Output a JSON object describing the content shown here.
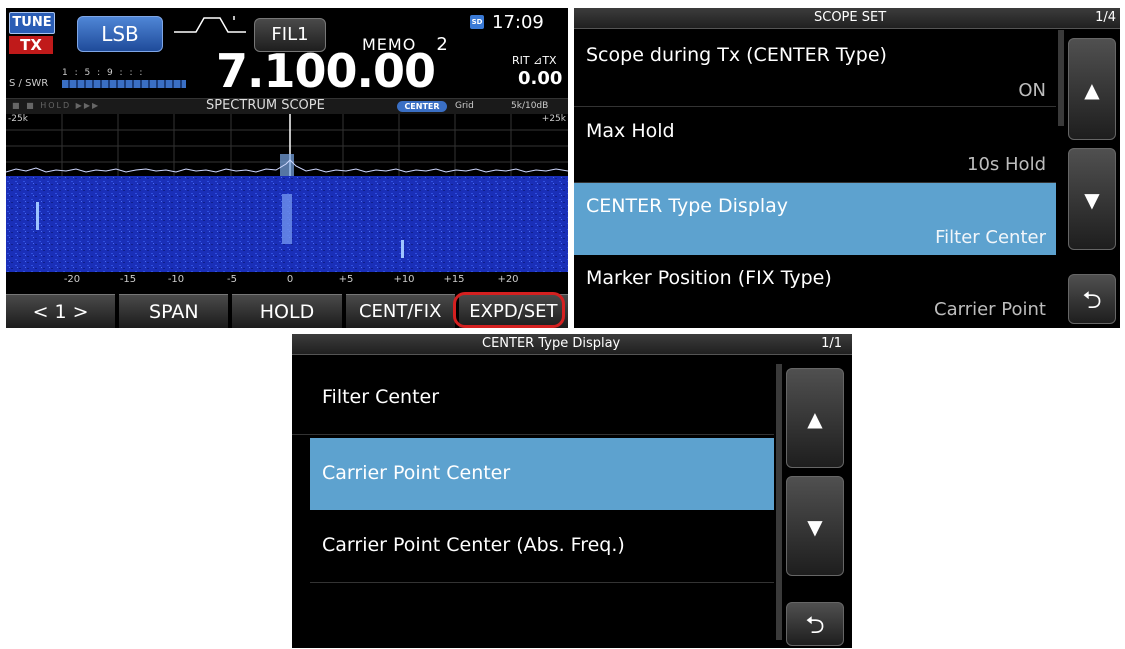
{
  "main_screen": {
    "tune_badge": "TUNE",
    "tx_badge": "TX",
    "mode": "LSB",
    "filter": "FIL1",
    "memo_label": "MEMO",
    "memo_number": "2",
    "time": "17:09",
    "sd_icon": "SD",
    "frequency": "7.100.00",
    "rit_label": "RIT ⊿TX",
    "rit_value": "0.00",
    "meter_label": "S / SWR",
    "meter_scale": "1 : 5 : 9 : : :",
    "scope_title": "SPECTRUM SCOPE",
    "scope_mode_badge": "CENTER",
    "grid_label": "Grid",
    "span_label": "5k/10dB",
    "scope_left_edge": "-25k",
    "scope_right_edge": "+25k",
    "scope_ticks": [
      "-20",
      "-15",
      "-10",
      "-5",
      "0",
      "+5",
      "+10",
      "+15",
      "+20"
    ],
    "softkeys": [
      "< 1 >",
      "SPAN",
      "HOLD",
      "CENT/FIX",
      "EXPD/SET"
    ],
    "highlighted_softkey": "EXPD/SET",
    "colors": {
      "waterfall": "#1a2fb8",
      "selection": "#5da2cf",
      "highlight_ring": "#d42020"
    }
  },
  "scope_set_menu": {
    "title": "SCOPE SET",
    "page": "1/4",
    "items": [
      {
        "label": "Scope during Tx (CENTER Type)",
        "value": "ON",
        "selected": false
      },
      {
        "label": "Max Hold",
        "value": "10s Hold",
        "selected": false
      },
      {
        "label": "CENTER Type Display",
        "value": "Filter Center",
        "selected": true
      },
      {
        "label": "Marker Position (FIX Type)",
        "value": "Carrier Point",
        "selected": false
      }
    ],
    "up_icon": "▲",
    "down_icon": "▼",
    "back_icon": "⮌"
  },
  "center_type_menu": {
    "title": "CENTER Type Display",
    "page": "1/1",
    "options": [
      {
        "label": "Filter Center",
        "selected": false
      },
      {
        "label": "Carrier Point Center",
        "selected": true
      },
      {
        "label": "Carrier Point Center (Abs. Freq.)",
        "selected": false
      }
    ],
    "up_icon": "▲",
    "down_icon": "▼",
    "back_icon": "⮌"
  }
}
